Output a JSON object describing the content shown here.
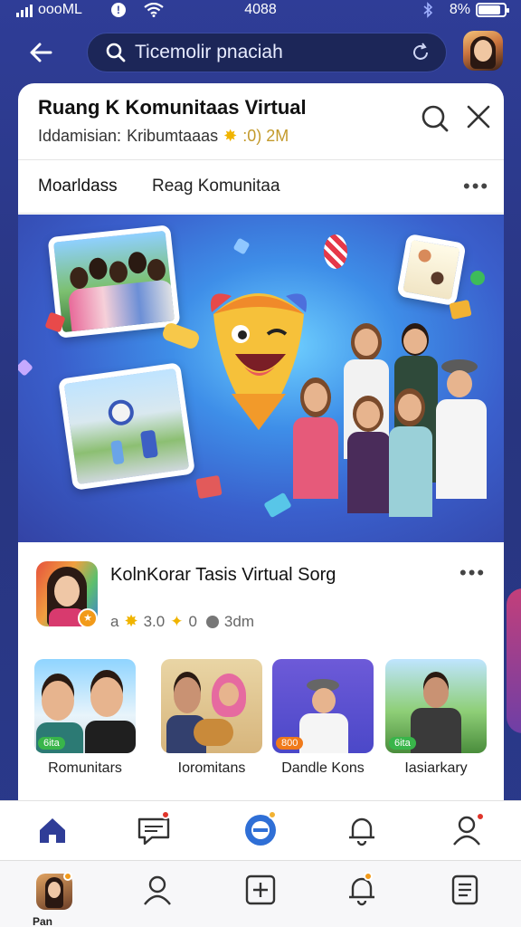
{
  "status_bar": {
    "carrier": "oooML",
    "time": "4088",
    "battery": "8%",
    "battery_level": 0.8
  },
  "top_bar": {
    "search_text": "Ticemolir pnaciah"
  },
  "card": {
    "title": "Ruang K Komunitaas Virtual",
    "subtitle_label": "Iddamisian:",
    "subtitle_value": "Kribumtaaas",
    "subtitle_count": ":0) 2M",
    "tabs": [
      {
        "label": "Moarldass"
      },
      {
        "label": "Reag Komunitaa"
      }
    ],
    "more": "•••"
  },
  "profile": {
    "name": "KolnKorar Tasis Virtual Sorg",
    "meta_a": "a",
    "meta_b": "3.0",
    "meta_c": "0",
    "meta_d": "3dm",
    "more": "•••"
  },
  "communities": [
    {
      "label": "Romunitars",
      "tag": "6ita",
      "tag_color": "#39b54a"
    },
    {
      "label": "Ioromitans",
      "tag": "",
      "tag_color": ""
    },
    {
      "label": "Dandle Kons",
      "tag": "800",
      "tag_color": "#f07a1a"
    },
    {
      "label": "Iasiarkary",
      "tag": "6ita",
      "tag_color": "#39b54a"
    }
  ],
  "nav_bottom": {
    "items": [
      "home-icon",
      "chat-icon",
      "badge-icon",
      "bell-icon",
      "user-icon"
    ]
  },
  "nav_secondary": {
    "profile_label": "Pan",
    "items": [
      "avatar",
      "user-icon",
      "add-icon",
      "bell-icon",
      "list-icon"
    ]
  },
  "colors": {
    "accent": "#2f3d97",
    "notification": "#e0352b",
    "badge_orange": "#f29a1a"
  }
}
